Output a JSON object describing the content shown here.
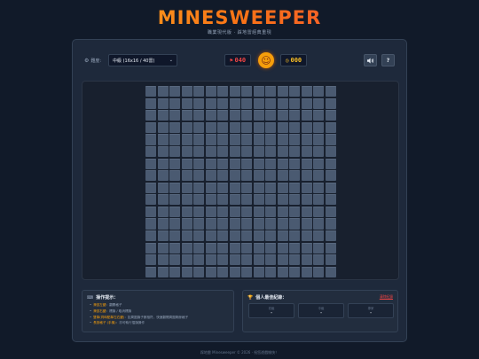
{
  "header": {
    "title": "MINESWEEPER",
    "subtitle": "職業現代版 · 踩地雷經典重現"
  },
  "toolbar": {
    "difficulty_label": "難度:",
    "difficulty_value": "中級 (16x16 / 40雷)",
    "mine_count": "040",
    "face": "☺",
    "timer": "000",
    "sound_icon": "speaker-icon",
    "help_label": "?"
  },
  "board": {
    "rows": 16,
    "cols": 16,
    "state": "all-covered",
    "cell_color": "#4a5a71"
  },
  "controls": {
    "title": "操作提示：",
    "items": [
      {
        "key": "滑鼠左鍵",
        "text": "：翻開格子"
      },
      {
        "key": "滑鼠右鍵",
        "text": "：標旗 / 取消標旗"
      },
      {
        "key": "雙擊(同時點擊左右鍵)",
        "text": "：如周圍旗子數相符，快速翻開周圍剩餘格子"
      },
      {
        "key": "長按格子 (手機)",
        "text": "：亦可執行插旗操作"
      }
    ]
  },
  "records": {
    "title": "個人最佳紀錄：",
    "clear_label": "清除紀錄",
    "cards": [
      {
        "label": "初級",
        "value": "-"
      },
      {
        "label": "中級",
        "value": "-"
      },
      {
        "label": "專家",
        "value": "-"
      }
    ]
  },
  "footer": {
    "text": "踩地雷 Minesweeper © 2026 · 祝您遊戲愉快！"
  },
  "colors": {
    "accent": "#f59e0b",
    "mine_counter": "#ef4444",
    "timer": "#fbbf24",
    "background": "#111a29",
    "panel": "#1e293b"
  }
}
